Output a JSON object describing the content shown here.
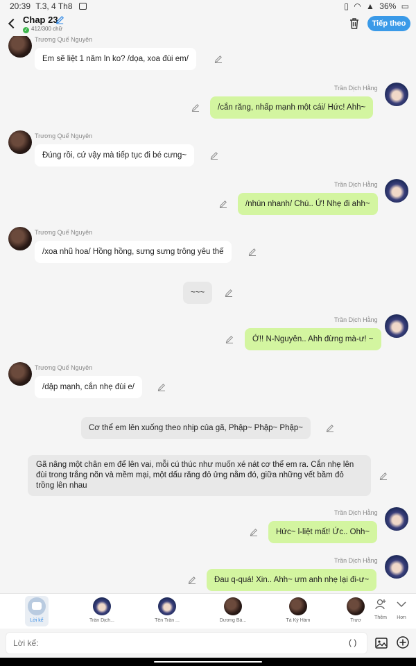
{
  "status": {
    "time": "20:39",
    "date": "T.3, 4 Th8",
    "battery": "36%"
  },
  "header": {
    "title": "Chap 23",
    "words": "412/300 chữ",
    "next_label": "Tiếp theo"
  },
  "messages": [
    {
      "speaker": "Trương Quế Nguyên",
      "text": "Em sẽ liệt 1 năm ln ko? /dọa, xoa đùi em/"
    },
    {
      "speaker": "Trần Dịch Hằng",
      "text": "/cắn răng, nhấp mạnh một cái/ Hức! Ahh~"
    },
    {
      "speaker": "Trương Quế Nguyên",
      "text": "Đúng rồi, cứ vậy mà tiếp tục đi bé cưng~"
    },
    {
      "speaker": "Trần Dịch Hằng",
      "text": "/nhún nhanh/ Chú.. Ứ! Nhẹ đi ahh~"
    },
    {
      "speaker": "Trương Quế Nguyên",
      "text": "/xoa nhũ hoa/ Hồng hồng, sưng sưng trông yêu thế"
    },
    {
      "speaker": "",
      "text": "~~~"
    },
    {
      "speaker": "Trần Dịch Hằng",
      "text": "Ớ!! N-Nguyên.. Ahh đừng mà-ư! ~"
    },
    {
      "speaker": "Trương Quế Nguyên",
      "text": "/dập mạnh, cắn nhẹ đùi e/"
    },
    {
      "speaker": "",
      "text": "Cơ thể em lên xuống theo nhịp của gã, Phập~ Phập~ Phập~"
    },
    {
      "speaker": "",
      "text": "Gã nâng một chân em để lên vai, mỗi cú thúc như muốn xé nát cơ thể em ra. Cắn nhẹ lên đùi trong trắng nõn và mềm mại, một dấu răng đỏ ửng nằm đó, giữa những vết bầm đỏ trồng lên nhau"
    },
    {
      "speaker": "Trần Dịch Hằng",
      "text": "Hức~ l-liệt mất! Ức.. Ohh~"
    },
    {
      "speaker": "Trần Dịch Hằng",
      "text": "Đau q-quá! Xin.. Ahh~ ưm anh nhẹ lại đi-ư~"
    }
  ],
  "characters": {
    "narration_label": "Lời kể",
    "items": [
      "Trần Dịch...",
      "Tên Trần ...",
      "Dương Bá...",
      "Tả Kỳ Hàm",
      "Trươ"
    ],
    "add_label": "Thêm",
    "more_label": "Hơn"
  },
  "input": {
    "placeholder": "Lời kể:",
    "paren_label": "( )"
  },
  "colors": {
    "accent": "#3a9ae8",
    "bubble_green": "#d3f5a0",
    "bubble_white": "#ffffff",
    "bubble_gray": "#e8e8e8"
  }
}
